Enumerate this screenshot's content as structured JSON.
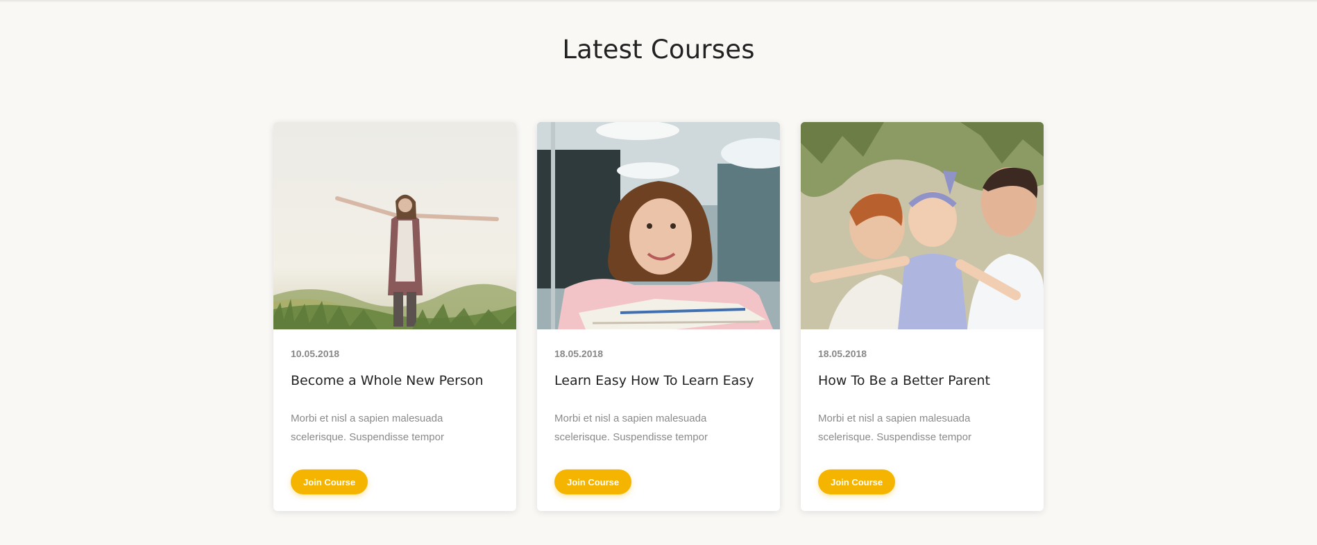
{
  "section": {
    "title": "Latest Courses"
  },
  "courses": [
    {
      "date": "10.05.2018",
      "title": "Become a Whole New Person",
      "description": "Morbi et nisl a sapien malesuada scelerisque. Suspendisse tempor",
      "button_label": "Join Course",
      "image": "woman-in-meadow-photo"
    },
    {
      "date": "18.05.2018",
      "title": "Learn Easy How To Learn Easy",
      "description": "Morbi et nisl a sapien malesuada scelerisque. Suspendisse tempor",
      "button_label": "Join Course",
      "image": "student-with-books-photo"
    },
    {
      "date": "18.05.2018",
      "title": "How To Be a Better Parent",
      "description": "Morbi et nisl a sapien malesuada scelerisque. Suspendisse tempor",
      "button_label": "Join Course",
      "image": "family-with-baby-photo"
    }
  ],
  "colors": {
    "accent": "#f4b400",
    "background": "#f9f8f5",
    "card": "#ffffff"
  }
}
